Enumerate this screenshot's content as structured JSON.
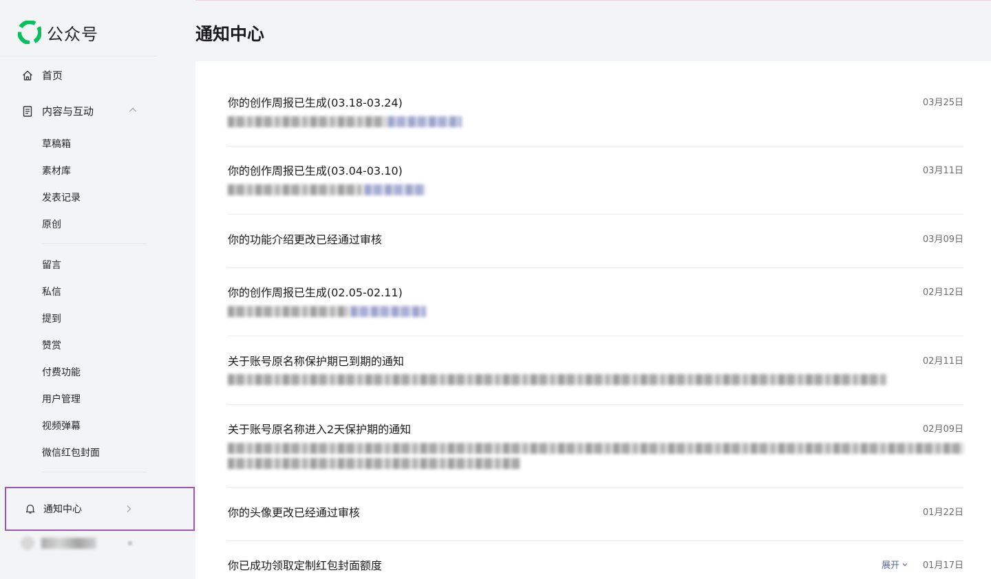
{
  "app": {
    "name": "公众号",
    "brand_color": "#07c160"
  },
  "sidebar": {
    "home_label": "首页",
    "content_label": "内容与互动",
    "sub_items_group1": [
      "草稿箱",
      "素材库",
      "发表记录",
      "原创"
    ],
    "sub_items_group2": [
      "留言",
      "私信",
      "提到",
      "赞赏",
      "付费功能",
      "用户管理",
      "视频弹幕",
      "微信红包封面"
    ],
    "notification_label": "通知中心"
  },
  "header": {
    "title": "通知中心"
  },
  "notifications": [
    {
      "title": "你的创作周报已生成(03.18-03.24)",
      "date": "03月25日"
    },
    {
      "title": "你的创作周报已生成(03.04-03.10)",
      "date": "03月11日"
    },
    {
      "title": "你的功能介绍更改已经通过审核",
      "date": "03月09日"
    },
    {
      "title": "你的创作周报已生成(02.05-02.11)",
      "date": "02月12日"
    },
    {
      "title": "关于账号原名称保护期已到期的通知",
      "date": "02月11日"
    },
    {
      "title": "关于账号原名称进入2天保护期的通知",
      "date": "02月09日"
    },
    {
      "title": "你的头像更改已经通过审核",
      "date": "01月22日"
    },
    {
      "title": "你已成功领取定制红包封面额度",
      "date": "01月17日",
      "expand_label": "展开"
    }
  ],
  "colors": {
    "link": "#576b95",
    "highlight_border": "#a055b5"
  }
}
